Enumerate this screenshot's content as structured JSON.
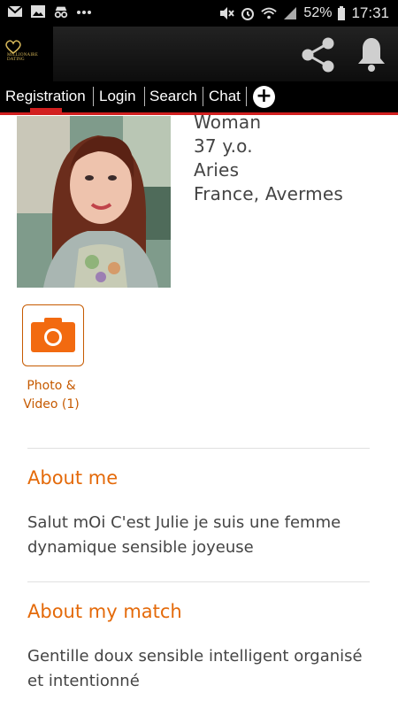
{
  "status_bar": {
    "battery": "52%",
    "time": "17:31",
    "left_icons": [
      "gmail-icon",
      "image-icon",
      "incognito-icon",
      "more-dots-icon"
    ],
    "right_icons": [
      "mute-icon",
      "alarm-icon",
      "wifi-icon",
      "signal-icon",
      "battery-icon"
    ]
  },
  "app_bar": {
    "logo_text": "MILLIONAIRE DATING",
    "actions": [
      "share-icon",
      "bell-icon"
    ]
  },
  "tabs": [
    {
      "label": "Registration",
      "active": true
    },
    {
      "label": "Login"
    },
    {
      "label": "Search"
    },
    {
      "label": "Chat"
    }
  ],
  "profile": {
    "gender": "Woman",
    "age": "37 y.o.",
    "sign": "Aries",
    "location": "France, Avermes"
  },
  "media_button": {
    "label_line1": "Photo &",
    "label_line2": "Video (1)"
  },
  "about_me": {
    "title": "About me",
    "text": "Salut mOi C'est Julie je suis une femme dynamique sensible joyeuse"
  },
  "about_match": {
    "title": "About my match",
    "text": "Gentille doux sensible intelligent organisé et intentionné"
  },
  "colors": {
    "accent": "#e46a0a",
    "tab_indicator": "#d21f1f",
    "bar_bg": "#000000"
  }
}
